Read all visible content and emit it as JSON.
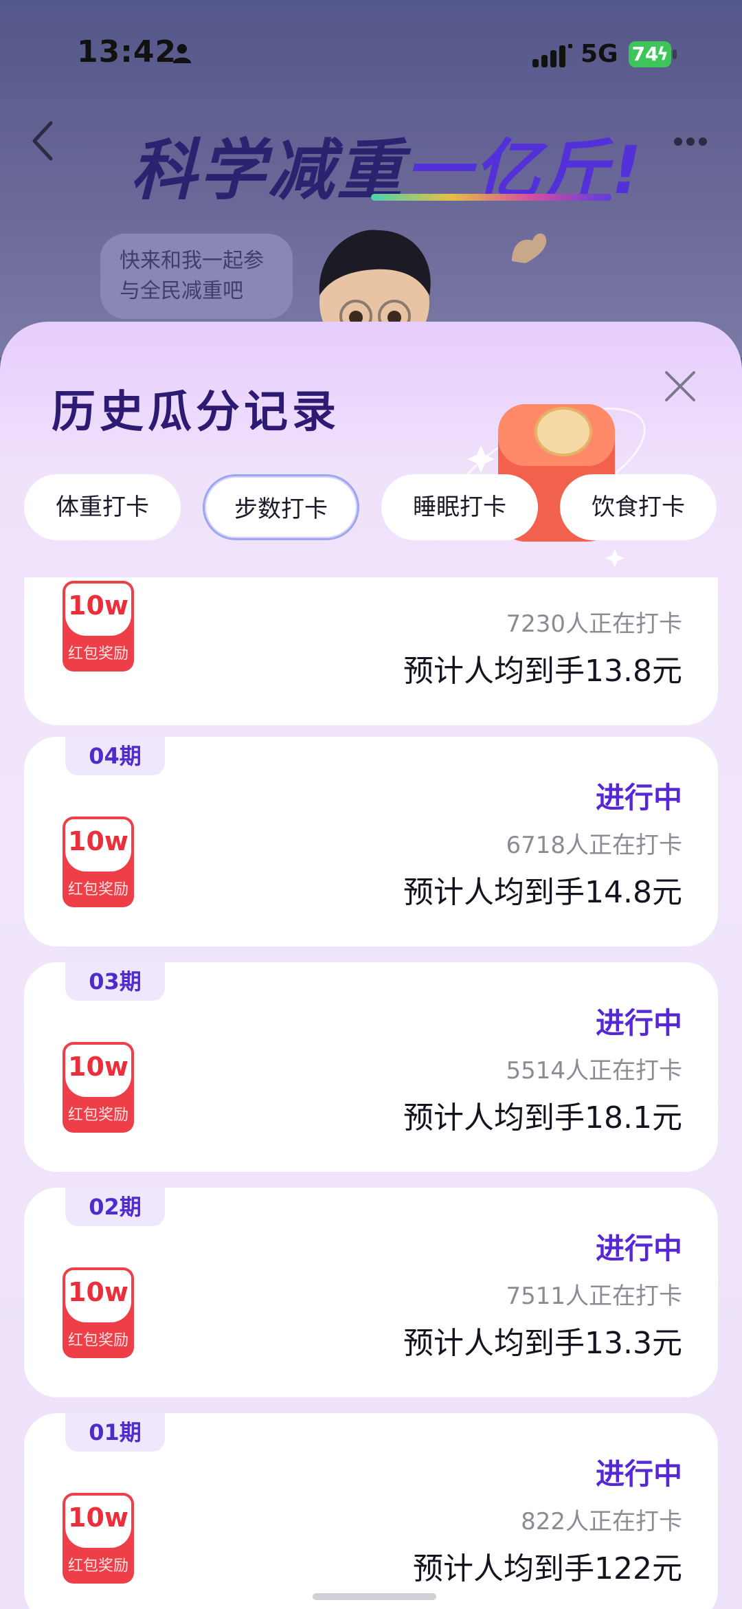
{
  "status_bar": {
    "time": "13:42",
    "network": "5G",
    "battery": "74"
  },
  "banner": {
    "title_main": "科学减重",
    "title_accent": "一亿斤!",
    "bubble_text": "快来和我一起参与全民减重吧"
  },
  "sheet": {
    "title": "历史瓜分记录",
    "tabs": [
      {
        "label": "体重打卡",
        "active": false
      },
      {
        "label": "步数打卡",
        "active": true
      },
      {
        "label": "睡眠打卡",
        "active": false
      },
      {
        "label": "饮食打卡",
        "active": false
      }
    ],
    "records": [
      {
        "period": "",
        "status": "",
        "count": "7230人正在打卡",
        "expect": "预计人均到手13.8元",
        "reward_amount": "10w",
        "reward_label": "红包奖励"
      },
      {
        "period": "04期",
        "status": "进行中",
        "count": "6718人正在打卡",
        "expect": "预计人均到手14.8元",
        "reward_amount": "10w",
        "reward_label": "红包奖励"
      },
      {
        "period": "03期",
        "status": "进行中",
        "count": "5514人正在打卡",
        "expect": "预计人均到手18.1元",
        "reward_amount": "10w",
        "reward_label": "红包奖励"
      },
      {
        "period": "02期",
        "status": "进行中",
        "count": "7511人正在打卡",
        "expect": "预计人均到手13.3元",
        "reward_amount": "10w",
        "reward_label": "红包奖励"
      },
      {
        "period": "01期",
        "status": "进行中",
        "count": "822人正在打卡",
        "expect": "预计人均到手122元",
        "reward_amount": "10w",
        "reward_label": "红包奖励"
      }
    ]
  },
  "colors": {
    "accent": "#5627d4",
    "reward": "#ee3f48",
    "title": "#2c1a73"
  }
}
